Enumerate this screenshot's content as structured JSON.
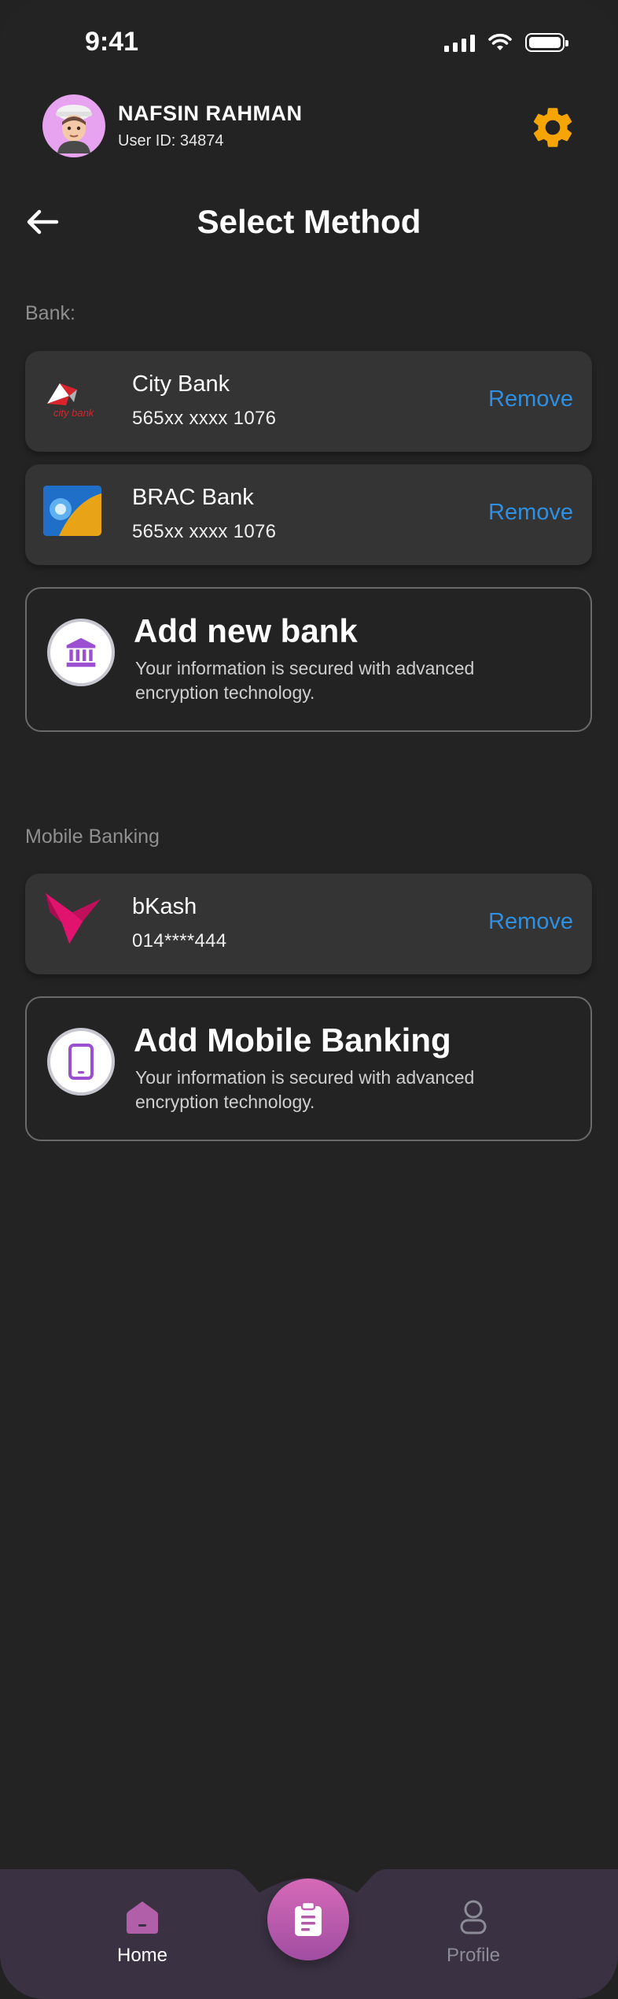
{
  "status_bar": {
    "time": "9:41"
  },
  "user": {
    "name": "NAFSIN RAHMAN",
    "id_text": "User ID: 34874"
  },
  "page": {
    "title": "Select Method"
  },
  "bank_section": {
    "label": "Bank:",
    "items": [
      {
        "name": "City Bank",
        "number": "565xx xxxx 1076",
        "logo_text": "city bank",
        "action": "Remove"
      },
      {
        "name": "BRAC Bank",
        "number": "565xx xxxx 1076",
        "action": "Remove"
      }
    ],
    "add": {
      "title": "Add new bank",
      "description": "Your information is secured with advanced encryption technology."
    }
  },
  "mobile_section": {
    "label": "Mobile Banking",
    "items": [
      {
        "name": "bKash",
        "number": "014****444",
        "action": "Remove"
      }
    ],
    "add": {
      "title": "Add Mobile Banking",
      "description": "Your information is secured with advanced encryption technology."
    }
  },
  "bottom_nav": {
    "home_label": "Home",
    "profile_label": "Profile"
  },
  "colors": {
    "background": "#232323",
    "card": "#343434",
    "accent_link": "#2f8fe0",
    "settings_gear": "#f5a400",
    "nav_bar": "#3a3142",
    "fab": "#c25fb1"
  },
  "icons": {
    "settings": "gear-icon",
    "back": "arrow-left-icon",
    "add_bank": "bank-building-icon",
    "add_mobile": "smartphone-icon",
    "home": "home-icon",
    "fab": "clipboard-icon",
    "profile": "user-icon"
  }
}
